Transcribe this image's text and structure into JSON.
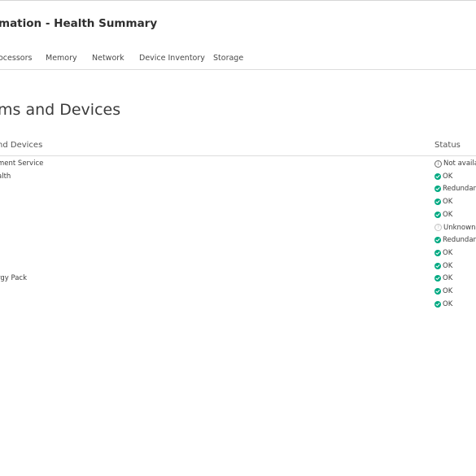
{
  "page": {
    "title": "mation - Health Summary"
  },
  "tabs": [
    {
      "label": "ocessors"
    },
    {
      "label": "Memory"
    },
    {
      "label": "Network"
    },
    {
      "label": "Device Inventory"
    },
    {
      "label": "Storage"
    }
  ],
  "section": {
    "heading": "ms and Devices"
  },
  "table": {
    "col_name": "nd Devices",
    "col_status": "Status",
    "rows": [
      {
        "name": "ment Service",
        "status": "Not availab",
        "icon": "info-icon"
      },
      {
        "name": "alth",
        "status": "OK",
        "icon": "ok-check-icon"
      },
      {
        "name": "",
        "status": "Redundant",
        "icon": "ok-check-icon"
      },
      {
        "name": "",
        "status": "OK",
        "icon": "ok-check-icon"
      },
      {
        "name": "",
        "status": "OK",
        "icon": "ok-check-icon"
      },
      {
        "name": "",
        "status": "Unknown",
        "icon": "unknown-icon"
      },
      {
        "name": "",
        "status": "Redundant",
        "icon": "ok-check-icon"
      },
      {
        "name": "",
        "status": "OK",
        "icon": "ok-check-icon"
      },
      {
        "name": "",
        "status": "OK",
        "icon": "ok-check-icon"
      },
      {
        "name": "rgy Pack",
        "status": "OK",
        "icon": "ok-check-icon"
      },
      {
        "name": "",
        "status": "OK",
        "icon": "ok-check-icon"
      },
      {
        "name": "",
        "status": "OK",
        "icon": "ok-check-icon"
      }
    ]
  },
  "colors": {
    "ok": "#01a982",
    "info": "#6b6b6b",
    "unknown": "#c3c3c3"
  }
}
